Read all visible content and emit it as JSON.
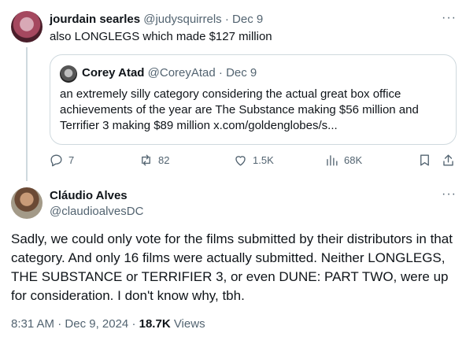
{
  "reply": {
    "name": "jourdain searles",
    "handle": "@judysquirrels",
    "sep": "·",
    "date": "Dec 9",
    "text": "also LONGLEGS which made $127 million",
    "avatar_icon": "profile-photo"
  },
  "quoted": {
    "name": "Corey Atad",
    "handle": "@CoreyAtad",
    "sep": "·",
    "date": "Dec 9",
    "text": "an extremely silly category considering the actual great box office achievements of the year are The Substance making $56 million and Terrifier 3 making $89 million x.com/goldenglobes/s..."
  },
  "actions": {
    "replies": "7",
    "reposts": "82",
    "likes": "1.5K",
    "views": "68K"
  },
  "main": {
    "name": "Cláudio Alves",
    "handle": "@claudioalvesDC",
    "text": "Sadly, we could only vote for the films submitted by their distributors in that category. And only 16 films were actually submitted. Neither LONGLEGS, THE SUBSTANCE or TERRIFIER 3, or even DUNE: PART TWO, were up for consideration. I don't know why, tbh.",
    "time": "8:31 AM",
    "sep": "·",
    "date": "Dec 9, 2024",
    "sep2": "·",
    "views_count": "18.7K",
    "views_label": "Views"
  },
  "more_label": "···",
  "colors": {
    "text": "#0f1419",
    "muted": "#536471",
    "border": "#cfd9de"
  }
}
